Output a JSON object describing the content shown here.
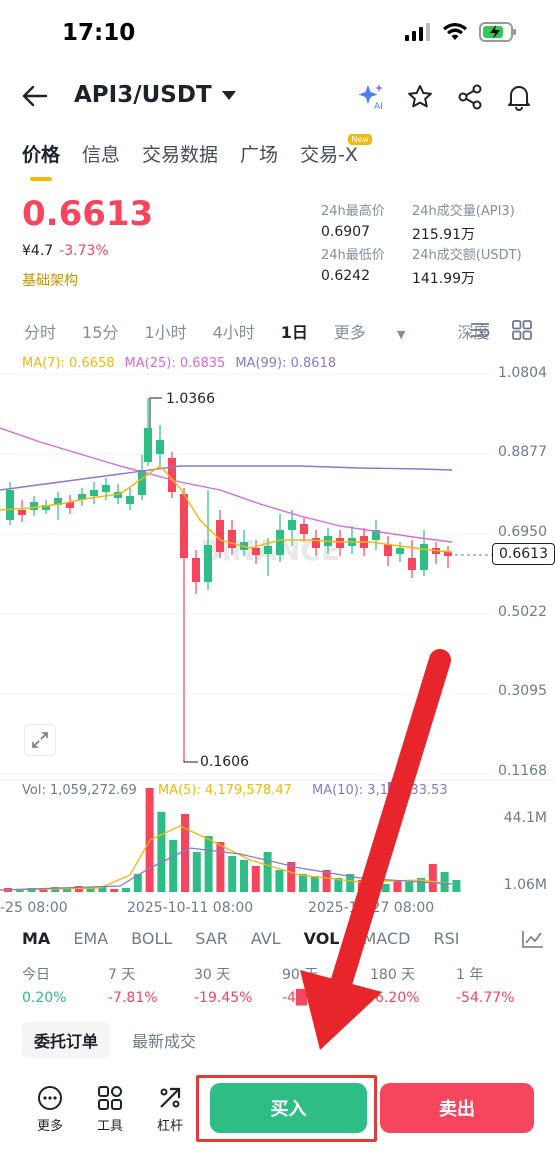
{
  "status": {
    "time": "17:10"
  },
  "header": {
    "pair": "API3/USDT"
  },
  "tabs": [
    {
      "label": "价格"
    },
    {
      "label": "信息"
    },
    {
      "label": "交易数据"
    },
    {
      "label": "广场"
    },
    {
      "label": "交易-X",
      "badge": "New"
    }
  ],
  "ticker": {
    "price": "0.6613",
    "cny": "¥4.7",
    "change": "-3.73%",
    "tag": "基础架构",
    "high_label": "24h最高价",
    "high": "0.6907",
    "low_label": "24h最低价",
    "low": "0.6242",
    "vol_base_label": "24h成交量(API3)",
    "vol_base": "215.91万",
    "vol_quote_label": "24h成交额(USDT)",
    "vol_quote": "141.99万"
  },
  "intervals": [
    "分时",
    "15分",
    "1小时",
    "4小时",
    "1日",
    "更多",
    "深度"
  ],
  "active_interval": "1日",
  "ma_legend": {
    "ma7": "MA(7): 0.6658",
    "ma25": "MA(25): 0.6835",
    "ma99": "MA(99): 0.8618"
  },
  "price_axis": [
    "1.0804",
    "0.8877",
    "0.6950",
    "0.5022",
    "0.3095",
    "0.1168"
  ],
  "current_price_label": "0.6613",
  "annotations": {
    "high": "1.0366",
    "low": "0.1606"
  },
  "watermark": "BINANCE",
  "volume_legend": {
    "vol": "Vol: 1,059,272.69",
    "ma5": "MA(5): 4,179,578.47",
    "ma10": "MA(10): 3,1█,133.53"
  },
  "volume_axis": [
    "44.1M",
    "1.06M"
  ],
  "date_axis": [
    "-25 08:00",
    "2025-10-11 08:00",
    "2025-10-27 08:00"
  ],
  "indicators": [
    "MA",
    "EMA",
    "BOLL",
    "SAR",
    "AVL",
    "VOL",
    "MACD",
    "RSI"
  ],
  "performance": [
    {
      "label": "今日",
      "value": "0.20%",
      "color": "#2ebd85"
    },
    {
      "label": "7 天",
      "value": "-7.81%",
      "color": "#f6465d"
    },
    {
      "label": "30 天",
      "value": "-19.45%",
      "color": "#f6465d"
    },
    {
      "label": "90 天",
      "value": "-4█",
      "color": "#f6465d"
    },
    {
      "label": "180 天",
      "value": "-6.20%",
      "color": "#f6465d"
    },
    {
      "label": "1 年",
      "value": "-54.77%",
      "color": "#f6465d"
    }
  ],
  "order_tabs": [
    "委托订单",
    "最新成交"
  ],
  "bottom": {
    "more": "更多",
    "tools": "工具",
    "margin": "杠杆",
    "buy": "买入",
    "sell": "卖出"
  },
  "colors": {
    "up": "#2ebd85",
    "down": "#f6465d",
    "ma7": "#f0b90b",
    "ma25": "#d66ad6",
    "ma99": "#8c78c8",
    "accent": "#f0b90b"
  }
}
